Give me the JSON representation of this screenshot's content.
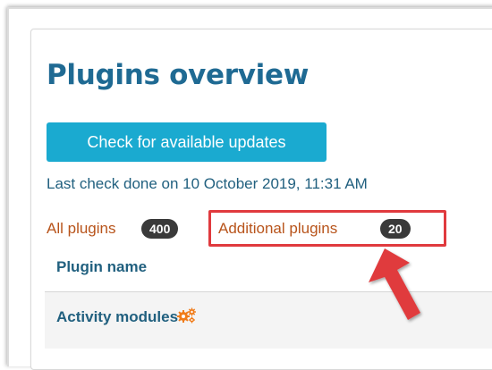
{
  "page": {
    "title": "Plugins overview",
    "check_button_label": "Check for available updates",
    "last_check_text": "Last check done on 10 October 2019, 11:31 AM"
  },
  "filters": {
    "all_label": "All plugins",
    "all_count": "400",
    "additional_label": "Additional plugins",
    "additional_count": "20"
  },
  "table": {
    "column_header": "Plugin name",
    "rows": [
      {
        "label": "Activity modules",
        "icon": "gears-icon"
      }
    ]
  },
  "annotation": {
    "highlight_color": "#e03a3e",
    "arrow_color": "#e03a3e",
    "arrow_icon": "arrow-up-left-icon"
  },
  "colors": {
    "title": "#1f6a93",
    "button_bg": "#1aaad0",
    "link": "#b8541b",
    "badge_bg": "#3a3a3a",
    "gear_icon": "#f07c1a"
  }
}
